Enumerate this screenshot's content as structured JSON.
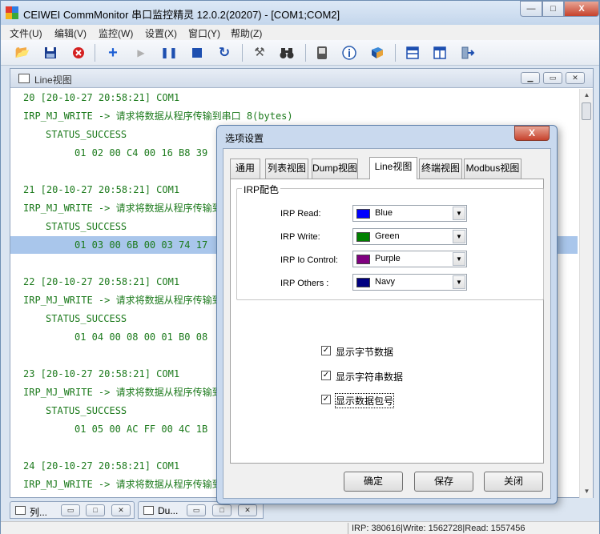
{
  "app": {
    "title": "CEIWEI CommMonitor 串口监控精灵 12.0.2(20207) - [COM1;COM2]",
    "min": "—",
    "max": "□",
    "close": "X"
  },
  "menu": [
    "文件(U)",
    "编辑(V)",
    "监控(W)",
    "设置(X)",
    "窗口(Y)",
    "帮助(Z)"
  ],
  "toolbar_icons": [
    "open-folder-icon",
    "save-icon",
    "stop-red-icon",
    "add-icon",
    "play-icon",
    "pause-icon",
    "stop-icon",
    "refresh-icon",
    "tools-icon",
    "binoculars-icon",
    "device-icon",
    "info-icon",
    "book-icon",
    "split-horizontal-icon",
    "split-vertical-icon",
    "exit-icon"
  ],
  "child": {
    "title": "Line视图",
    "log": [
      {
        "text": "20 [20-10-27 20:58:21] COM1",
        "indent": 0,
        "hl": false
      },
      {
        "text": "IRP_MJ_WRITE -> 请求将数据从程序传输到串口 8(bytes)",
        "indent": 0,
        "hl": false
      },
      {
        "text": "STATUS_SUCCESS",
        "indent": 1,
        "hl": false
      },
      {
        "text": "01 02 00 C4 00 16 B8 39",
        "indent": 2,
        "hl": false
      },
      {
        "text": "",
        "indent": 0,
        "hl": false
      },
      {
        "text": "21 [20-10-27 20:58:21] COM1",
        "indent": 0,
        "hl": false
      },
      {
        "text": "IRP_MJ_WRITE -> 请求将数据从程序传输到串口 8(bytes)",
        "indent": 0,
        "hl": false
      },
      {
        "text": "STATUS_SUCCESS",
        "indent": 1,
        "hl": false
      },
      {
        "text": "01 03 00 6B 00 03 74 17",
        "indent": 2,
        "hl": true
      },
      {
        "text": "",
        "indent": 0,
        "hl": false
      },
      {
        "text": "22 [20-10-27 20:58:21] COM1",
        "indent": 0,
        "hl": false
      },
      {
        "text": "IRP_MJ_WRITE -> 请求将数据从程序传输到串口 8(bytes)",
        "indent": 0,
        "hl": false
      },
      {
        "text": "STATUS_SUCCESS",
        "indent": 1,
        "hl": false
      },
      {
        "text": "01 04 00 08 00 01 B0 08",
        "indent": 2,
        "hl": false
      },
      {
        "text": "",
        "indent": 0,
        "hl": false
      },
      {
        "text": "23 [20-10-27 20:58:21] COM1",
        "indent": 0,
        "hl": false
      },
      {
        "text": "IRP_MJ_WRITE -> 请求将数据从程序传输到串口 8(bytes)",
        "indent": 0,
        "hl": false
      },
      {
        "text": "STATUS_SUCCESS",
        "indent": 1,
        "hl": false
      },
      {
        "text": "01 05 00 AC FF 00 4C 1B",
        "indent": 2,
        "hl": false
      },
      {
        "text": "",
        "indent": 0,
        "hl": false
      },
      {
        "text": "24 [20-10-27 20:58:21] COM1",
        "indent": 0,
        "hl": false
      },
      {
        "text": "IRP_MJ_WRITE -> 请求将数据从程序传输到串口 8(bytes)",
        "indent": 0,
        "hl": false
      }
    ]
  },
  "bottom_tabs": [
    {
      "label": "列..."
    },
    {
      "label": "Du..."
    }
  ],
  "status": {
    "text": "IRP: 380616|Write: 1562728|Read: 1557456"
  },
  "dialog": {
    "title": "选项设置",
    "close": "X",
    "tabs": [
      "通用",
      "列表视图",
      "Dump视图",
      "Line视图",
      "终端视图",
      "Modbus视图"
    ],
    "active_tab": 3,
    "group_title": "IRP配色",
    "colors": [
      {
        "label": "IRP Read:",
        "value": "Blue",
        "hex": "#0000ff"
      },
      {
        "label": "IRP Write:",
        "value": "Green",
        "hex": "#008000"
      },
      {
        "label": "IRP Io Control:",
        "value": "Purple",
        "hex": "#800080"
      },
      {
        "label": "IRP Others :",
        "value": "Navy",
        "hex": "#000080"
      }
    ],
    "checkboxes": [
      {
        "label": "显示字节数据",
        "checked": true
      },
      {
        "label": "显示字符串数据",
        "checked": true
      },
      {
        "label": "显示数据包号",
        "checked": true
      }
    ],
    "buttons": {
      "ok": "确定",
      "save": "保存",
      "close": "关闭"
    }
  }
}
